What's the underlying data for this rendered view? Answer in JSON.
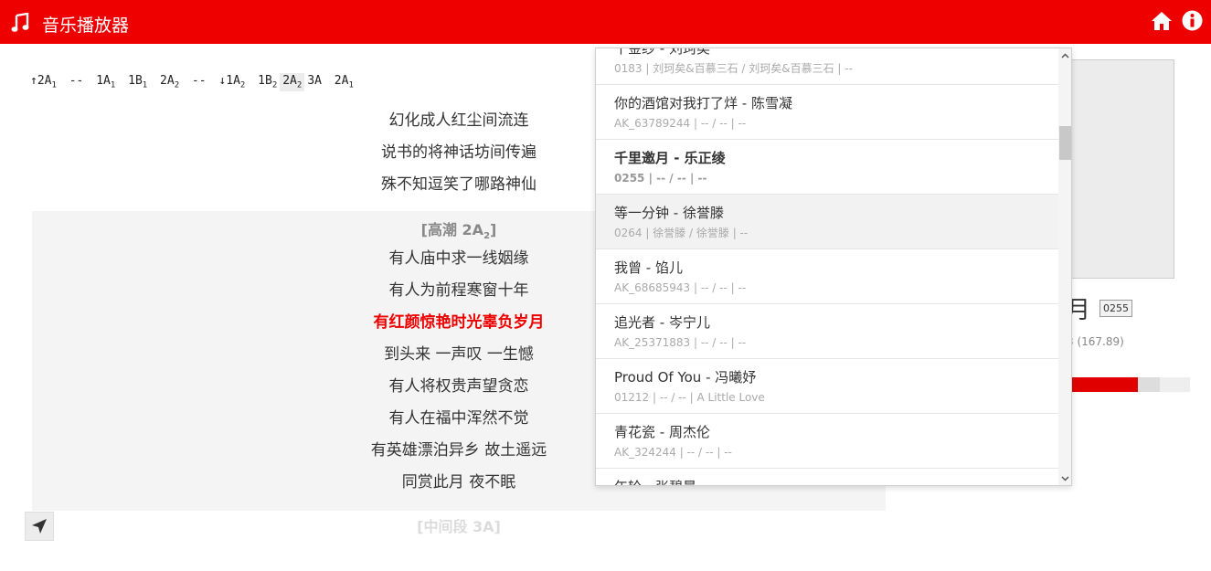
{
  "app": {
    "title": "音乐播放器"
  },
  "header": {
    "icons": [
      "music-note-icon",
      "home-icon",
      "info-icon"
    ]
  },
  "structure": [
    {
      "text": "↑2A",
      "sub": "1"
    },
    {
      "text": " -- ",
      "sub": ""
    },
    {
      "text": "1A",
      "sub": "1"
    },
    {
      "text": " 1B",
      "sub": "1"
    },
    {
      "text": " 2A",
      "sub": "2"
    },
    {
      "text": " -- ",
      "sub": ""
    },
    {
      "text": "↓1A",
      "sub": "2"
    },
    {
      "text": " 1B",
      "sub": "2"
    },
    {
      "text": "2A",
      "sub": "2",
      "current": true
    },
    {
      "text": "3A",
      "sub": ""
    },
    {
      "text": " 2A",
      "sub": "1"
    }
  ],
  "lyrics": {
    "verse_lines": [
      "幻化成人红尘间流连",
      "说书的将神话坊间传遍",
      "殊不知逗笑了哪路神仙"
    ],
    "chorus_tag": "[高潮 2A",
    "chorus_tag_sub": "2",
    "chorus_tag_end": "]",
    "chorus_lines": [
      "有人庙中求一线姻缘",
      "有人为前程寒窗十年",
      "有红颜惊艳时光辜负岁月",
      "到头来 一声叹 一生憾",
      "有人将权贵声望贪恋",
      "有人在福中浑然不觉",
      "有英雄漂泊异乡 故土遥远",
      "同赏此月 夜不眠"
    ],
    "active_index": 2,
    "next_tag": "[中间段 3A]"
  },
  "now_playing": {
    "title_partial": "月",
    "id": "0255",
    "duration_partial": "3 (167.89)",
    "progress_fraction": 0.57,
    "buffer_fraction": 0.75
  },
  "song_list": [
    {
      "name": "千金纱 - 刘珂矣",
      "meta": "0183 | 刘珂矣&百慕三石 / 刘珂矣&百慕三石 | --"
    },
    {
      "name": "你的酒馆对我打了烊 - 陈雪凝",
      "meta": "AK_63789244 | -- / -- | --"
    },
    {
      "name": "千里邀月 - 乐正绫",
      "meta": "0255 | -- / -- | --",
      "current": true
    },
    {
      "name": "等一分钟 - 徐誉滕",
      "meta": "0264 | 徐誉滕 / 徐誉滕 | --",
      "hover": true
    },
    {
      "name": "我曾 - 馅儿",
      "meta": "AK_68685943 | -- / -- | --"
    },
    {
      "name": "追光者 - 岑宁儿",
      "meta": "AK_25371883 | -- / -- | --"
    },
    {
      "name": "Proud Of You - 冯曦妤",
      "meta": "01212 | -- / -- | A Little Love"
    },
    {
      "name": "青花瓷 - 周杰伦",
      "meta": "AK_324244 | -- / -- | --"
    },
    {
      "name": "年轮 - 张碧晨",
      "meta": ""
    }
  ]
}
